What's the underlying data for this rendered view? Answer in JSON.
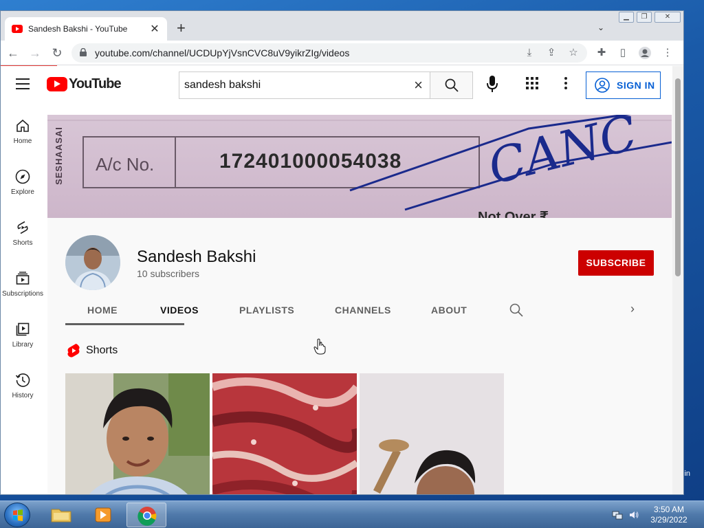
{
  "browser": {
    "tab_title": "Sandesh Bakshi - YouTube",
    "url": "youtube.com/channel/UCDUpYjVsnCVC8uV9yikrZIg/videos"
  },
  "youtube": {
    "logo_text": "YouTube",
    "search_value": "sandesh bakshi",
    "signin_label": "SIGN IN",
    "guide": [
      {
        "label": "Home",
        "icon": "home-icon"
      },
      {
        "label": "Explore",
        "icon": "compass-icon"
      },
      {
        "label": "Shorts",
        "icon": "shorts-icon"
      },
      {
        "label": "Subscriptions",
        "icon": "subscriptions-icon"
      },
      {
        "label": "Library",
        "icon": "library-icon"
      },
      {
        "label": "History",
        "icon": "history-icon"
      }
    ],
    "banner": {
      "side_text": "SESHAASAI",
      "ac_label": "A/c No.",
      "ac_number": "172401000054038",
      "stamp_text": "CANC",
      "footer_text": "Not Over ₹"
    },
    "channel": {
      "name": "Sandesh Bakshi",
      "subscribers": "10 subscribers",
      "subscribe_label": "SUBSCRIBE",
      "tabs": [
        "HOME",
        "VIDEOS",
        "PLAYLISTS",
        "CHANNELS",
        "ABOUT"
      ],
      "active_tab": "VIDEOS"
    },
    "shorts": {
      "title": "Shorts"
    }
  },
  "desktop": {
    "peek_text": "in"
  },
  "taskbar": {
    "time": "3:50 AM",
    "date": "3/29/2022"
  }
}
